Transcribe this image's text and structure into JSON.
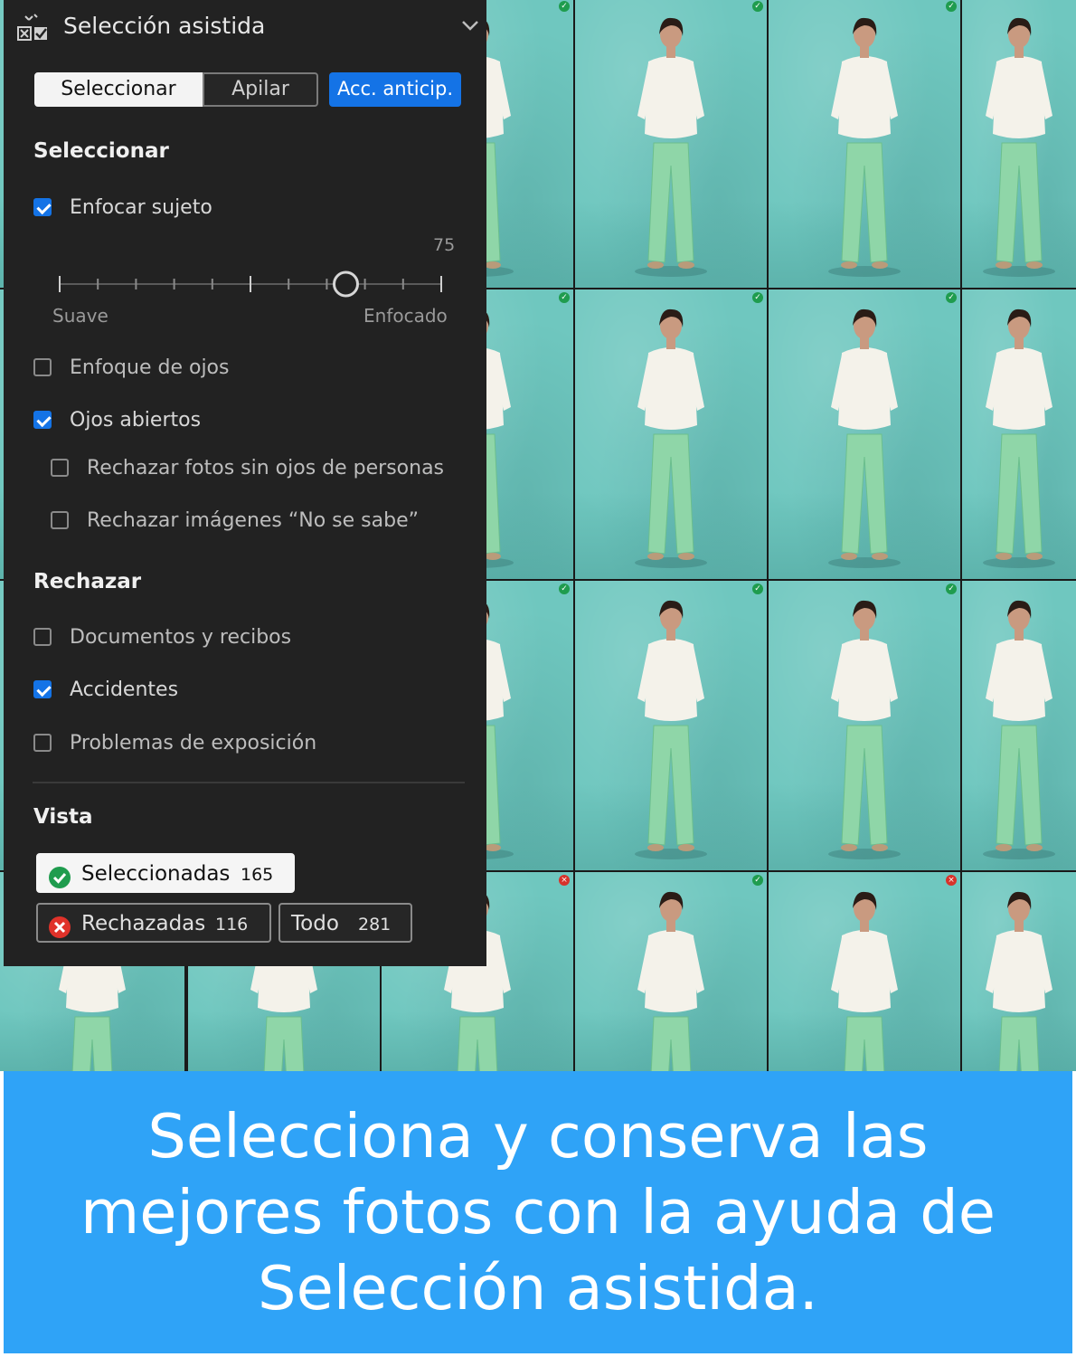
{
  "panel": {
    "title": "Selección asistida",
    "icons": {
      "panel_icon": "culling-checkbox-icon",
      "collapse_icon": "chevron-down-icon"
    },
    "tabs": {
      "select": "Seleccionar",
      "stack": "Apilar"
    },
    "action_button": "Acc. anticip.",
    "section_select": "Seleccionar",
    "focus_subject": {
      "label": "Enfocar sujeto",
      "checked": true
    },
    "slider": {
      "value": "75",
      "value_fraction": 0.75,
      "min_label": "Suave",
      "max_label": "Enfocado"
    },
    "eye_focus": {
      "label": "Enfoque de ojos",
      "checked": false
    },
    "eyes_open": {
      "label": "Ojos abiertos",
      "checked": true
    },
    "reject_no_eyes": {
      "label": "Rechazar fotos sin ojos de personas",
      "checked": false
    },
    "reject_unknown": {
      "label": "Rechazar imágenes “No se sabe”",
      "checked": false
    },
    "section_reject": "Rechazar",
    "documents": {
      "label": "Documentos y recibos",
      "checked": false
    },
    "accidents": {
      "label": "Accidentes",
      "checked": true
    },
    "exposure": {
      "label": "Problemas de exposición",
      "checked": false
    },
    "section_view": "Vista",
    "view": {
      "selected": {
        "label": "Seleccionadas",
        "count": "165",
        "icon": "check-circle-icon"
      },
      "rejected": {
        "label": "Rechazadas",
        "count": "116",
        "icon": "x-circle-icon"
      },
      "all": {
        "label": "Todo",
        "count": "281"
      }
    }
  },
  "grid": {
    "status_rows": [
      [
        "ok",
        "ok",
        "ok",
        "ok"
      ],
      [
        "ok",
        "ok",
        "ok",
        "ok"
      ],
      [
        "ok",
        "ok",
        "ok",
        "ok"
      ],
      [
        "bad",
        "ok",
        "bad",
        "ok"
      ]
    ],
    "colors": {
      "backdrop": "#6fc7bf",
      "accepted": "#1f9c4e",
      "rejected": "#d7322a"
    }
  },
  "caption": {
    "line1": "Selecciona y conserva las",
    "line2": "mejores fotos con la ayuda de",
    "line3": "Selección asistida."
  },
  "colors": {
    "accent": "#1473e6",
    "panel_bg": "#222222",
    "caption_bg": "#2fa3f7"
  }
}
